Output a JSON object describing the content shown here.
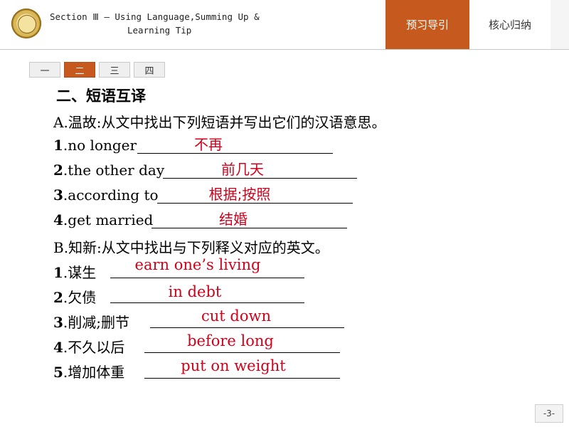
{
  "header": {
    "section_line1": "Section Ⅲ — Using Language,Summing Up &",
    "section_line2": "Learning Tip",
    "tab_preview": "预习导引",
    "tab_summary": "核心归纳"
  },
  "pager": [
    "一",
    "二",
    "三",
    "四"
  ],
  "pager_active_index": 1,
  "heading": "二、短语互译",
  "part_a": {
    "instruction": "A.温故:从文中找出下列短语并写出它们的汉语意思。",
    "items": [
      {
        "num": "1",
        "text": ".no longer",
        "answer": "不再"
      },
      {
        "num": "2",
        "text": ".the other day",
        "answer": "前几天"
      },
      {
        "num": "3",
        "text": ".according to",
        "answer": "根据;按照"
      },
      {
        "num": "4",
        "text": ".get married",
        "answer": "结婚"
      }
    ]
  },
  "part_b": {
    "instruction": "B.知新:从文中找出与下列释义对应的英文。",
    "items": [
      {
        "num": "1",
        "text": ".谋生",
        "answer": "earn one’s living"
      },
      {
        "num": "2",
        "text": ".欠债",
        "answer": "in debt"
      },
      {
        "num": "3",
        "text": ".削减;删节",
        "answer": "cut down"
      },
      {
        "num": "4",
        "text": ".不久以后",
        "answer": "before long"
      },
      {
        "num": "5",
        "text": ".增加体重",
        "answer": "put on weight"
      }
    ]
  },
  "page_number": "-3-",
  "colors": {
    "accent": "#c65a1e",
    "answer": "#d0021b"
  }
}
